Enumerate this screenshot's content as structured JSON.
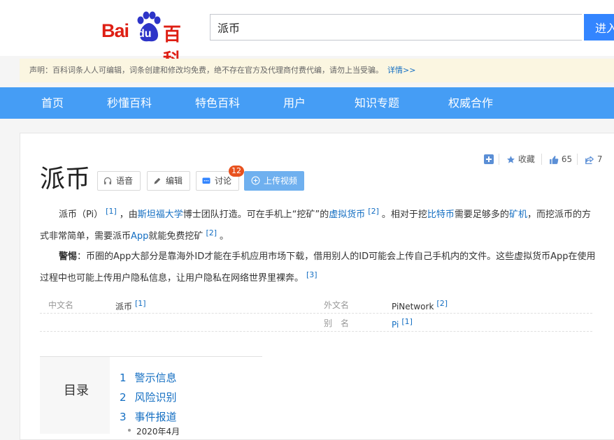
{
  "header": {
    "logo": {
      "part1": "Bai",
      "part2": "du",
      "part3": "百科"
    },
    "search_value": "派币",
    "search_button": "进入词条"
  },
  "notice": {
    "text": "声明：百科词条人人可编辑，词条创建和修改均免费，绝不存在官方及代理商付费代编，请勿上当受骗。",
    "link": "详情>>"
  },
  "nav": {
    "items": [
      "首页",
      "秒懂百科",
      "特色百科",
      "用户",
      "知识专题",
      "权威合作"
    ]
  },
  "share": {
    "collect": "收藏",
    "likes": "65",
    "shares": "7"
  },
  "entry": {
    "title": "派币",
    "buttons": {
      "voice": "语音",
      "edit": "编辑",
      "discuss": "讨论",
      "discuss_count": "12",
      "upload": "上传视频"
    },
    "p1": {
      "t1": "派币（Pi）",
      "r1": "[1]",
      "t2": "，由",
      "l1": "斯坦福大学",
      "t3": "博士团队打造。可在手机上“挖矿”的",
      "l2": "虚拟货币",
      "r2": "[2]",
      "t4": "。相对于挖",
      "l3": "比特币",
      "t5": "需要足够多的",
      "l4": "矿机",
      "t6": "，而挖派币的方式非常简单，需要派币",
      "l5": "App",
      "t7": "就能免费挖矿",
      "r3": "[2]",
      "t8": "。"
    },
    "p2": {
      "label": "警惕",
      "text": "：币圈的App大部分是靠海外ID才能在手机应用市场下载，借用别人的ID可能会上传自己手机内的文件。这些虚拟货币App在使用过程中也可能上传用户隐私信息，让用户隐私在网络世界里裸奔。",
      "ref": "[3]"
    },
    "info": {
      "cn_name_k": "中文名",
      "cn_name_v": "派币",
      "cn_name_ref": "[1]",
      "en_name_k": "外文名",
      "en_name_v": "PiNetwork",
      "en_name_ref": "[2]",
      "alias_k": "别　名",
      "alias_v": "Pi",
      "alias_ref": "[1]"
    }
  },
  "toc": {
    "title": "目录",
    "items": [
      {
        "num": "1",
        "label": "警示信息"
      },
      {
        "num": "2",
        "label": "风险识别"
      },
      {
        "num": "3",
        "label": "事件报道"
      }
    ],
    "sub": "2020年4月"
  },
  "colors": {
    "brand_red": "#de1f14",
    "brand_blue": "#2d34c8",
    "nav_blue": "#459df5",
    "link_blue": "#136ec2",
    "badge_orange": "#e8521f"
  }
}
